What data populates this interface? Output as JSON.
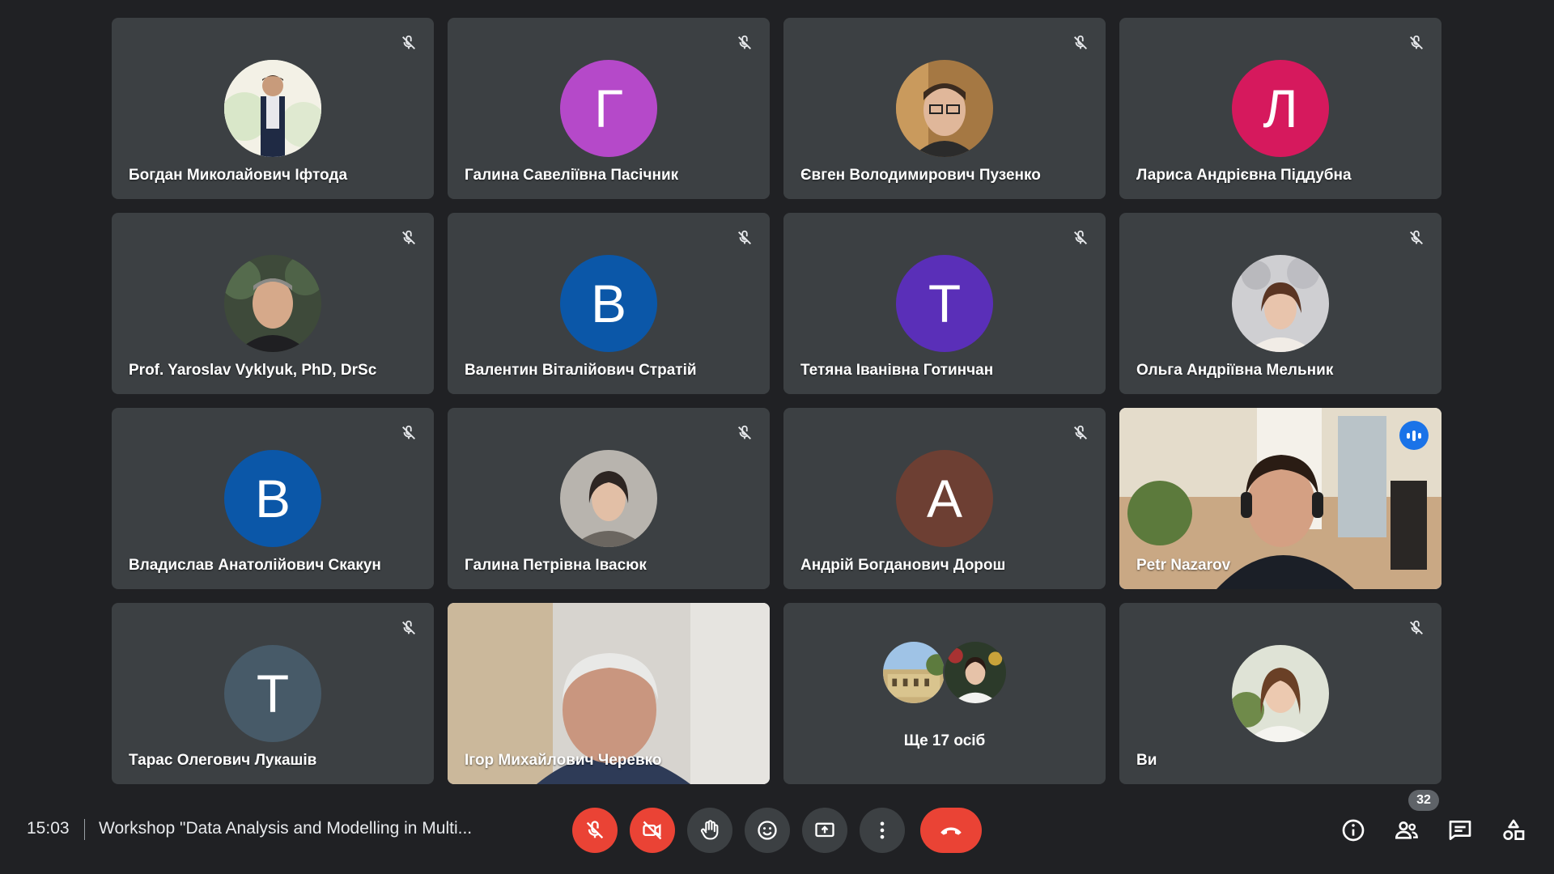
{
  "colors": {
    "background": "#202124",
    "tile": "#3c4043",
    "danger": "#ea4335",
    "speaking_outline": "#8ab4f8",
    "speaking_badge": "#1a73e8"
  },
  "participants": [
    {
      "name": "Богдан Миколайович Іфтода",
      "initial": "",
      "avatar": "photo-man-suit",
      "muted": true
    },
    {
      "name": "Галина Савеліївна Пасічник",
      "initial": "Г",
      "avatar_color": "#b549c9",
      "muted": true
    },
    {
      "name": "Євген Володимирович Пузенко",
      "initial": "",
      "avatar": "photo-young-man-glasses",
      "muted": true
    },
    {
      "name": "Лариса Андрієвна Піддубна",
      "initial": "Л",
      "avatar_color": "#d6195d",
      "muted": true
    },
    {
      "name": "Prof. Yaroslav Vyklyuk, PhD, DrSc",
      "initial": "",
      "avatar": "photo-man-portrait",
      "muted": true
    },
    {
      "name": "Валентин Віталійович Стратій",
      "initial": "В",
      "avatar_color": "#0b57a8",
      "muted": true
    },
    {
      "name": "Тетяна Іванівна Готинчан",
      "initial": "Т",
      "avatar_color": "#5a2fb8",
      "muted": true
    },
    {
      "name": "Ольга Андріївна Мельник",
      "initial": "",
      "avatar": "photo-woman-balloons",
      "muted": true
    },
    {
      "name": "Владислав Анатолійович Скакун",
      "initial": "В",
      "avatar_color": "#0b57a8",
      "muted": true
    },
    {
      "name": "Галина Петрівна Івасюк",
      "initial": "",
      "avatar": "photo-woman-portrait",
      "muted": true
    },
    {
      "name": "Андрій Богданович Дорош",
      "initial": "А",
      "avatar_color": "#6d3f33",
      "muted": true
    },
    {
      "name": "Petr Nazarov",
      "initial": "",
      "avatar": "video-man-headset",
      "muted": false,
      "speaking": true
    },
    {
      "name": "Тарас Олегович Лукашів",
      "initial": "Т",
      "avatar_color": "#475a68",
      "muted": true
    },
    {
      "name": "Ігор Михайлович Черевко",
      "initial": "",
      "avatar": "video-older-man",
      "muted": false
    },
    {
      "name": "",
      "initial": "",
      "avatar": "more-tile",
      "more_label": "Ще 17 осіб"
    },
    {
      "name": "Ви",
      "initial": "",
      "avatar": "photo-woman-white-sweater",
      "muted": true
    }
  ],
  "bottom_bar": {
    "time": "15:03",
    "meeting_title": "Workshop \"Data Analysis and Modelling in Multi...",
    "controls": [
      {
        "icon": "mic-off-icon",
        "state": "off"
      },
      {
        "icon": "camera-off-icon",
        "state": "off"
      },
      {
        "icon": "raise-hand-icon"
      },
      {
        "icon": "emoji-icon"
      },
      {
        "icon": "present-screen-icon"
      },
      {
        "icon": "more-options-icon"
      },
      {
        "icon": "end-call-icon"
      }
    ],
    "right_icons": [
      "info-icon",
      "people-icon",
      "chat-icon",
      "activities-icon"
    ],
    "participant_count": "32"
  }
}
